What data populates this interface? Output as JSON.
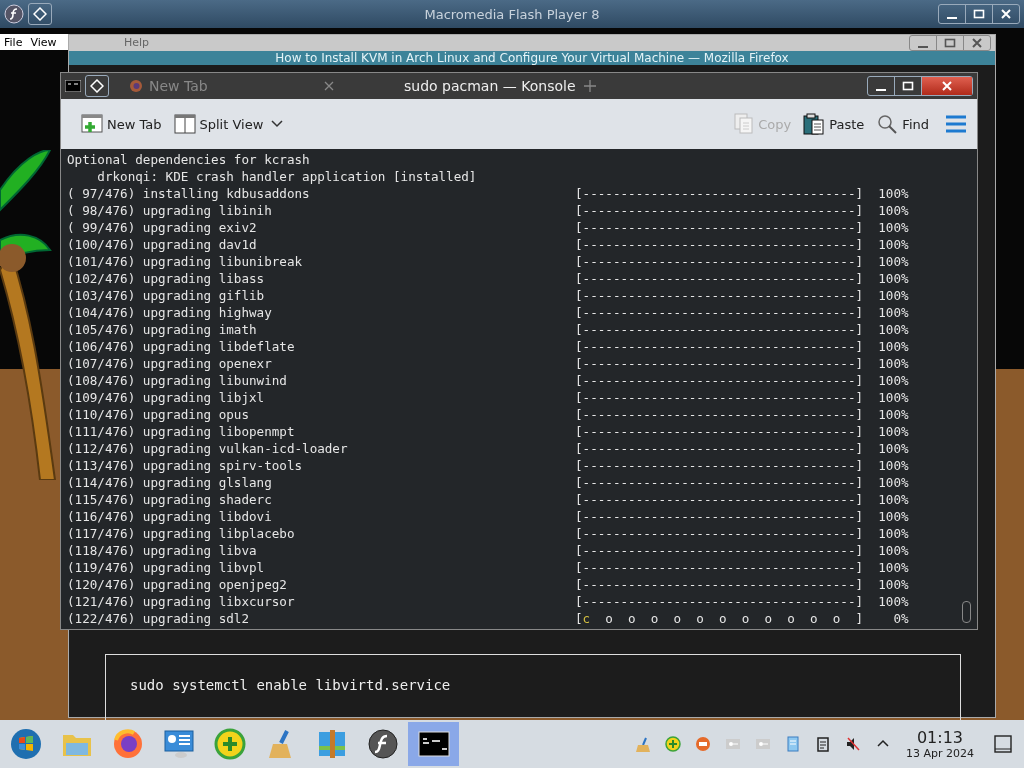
{
  "flash_window": {
    "title": "Macromedia Flash Player 8",
    "menu": [
      {
        "label": "File"
      },
      {
        "label": "View"
      },
      {
        "label": "Help"
      }
    ]
  },
  "browser_window": {
    "title": "How to Install KVM in Arch Linux and Configure Your Virtual Machine — Mozilla Firefox",
    "code": "sudo systemctl enable libvirtd.service"
  },
  "konsole": {
    "title": "sudo pacman — Konsole",
    "ghost_tab": "New Tab",
    "toolbar": [
      {
        "kind": "new-tab",
        "label": "New Tab",
        "disabled": false
      },
      {
        "kind": "split",
        "label": "Split View",
        "disabled": false
      },
      {
        "kind": "copy",
        "label": "Copy",
        "disabled": true
      },
      {
        "kind": "paste",
        "label": "Paste",
        "disabled": false
      },
      {
        "kind": "find",
        "label": "Find",
        "disabled": false
      }
    ],
    "lines": [
      {
        "kind": "text",
        "text": "Optional dependencies for kcrash"
      },
      {
        "kind": "text",
        "text": "    drkonqi: KDE crash handler application [installed]"
      },
      {
        "kind": "progress",
        "text": "( 97/476) installing kdbusaddons",
        "bar": "[------------------------------------]",
        "percent": "100%"
      },
      {
        "kind": "progress",
        "text": "( 98/476) upgrading libinih",
        "bar": "[------------------------------------]",
        "percent": "100%"
      },
      {
        "kind": "progress",
        "text": "( 99/476) upgrading exiv2",
        "bar": "[------------------------------------]",
        "percent": "100%"
      },
      {
        "kind": "progress",
        "text": "(100/476) upgrading dav1d",
        "bar": "[------------------------------------]",
        "percent": "100%"
      },
      {
        "kind": "progress",
        "text": "(101/476) upgrading libunibreak",
        "bar": "[------------------------------------]",
        "percent": "100%"
      },
      {
        "kind": "progress",
        "text": "(102/476) upgrading libass",
        "bar": "[------------------------------------]",
        "percent": "100%"
      },
      {
        "kind": "progress",
        "text": "(103/476) upgrading giflib",
        "bar": "[------------------------------------]",
        "percent": "100%"
      },
      {
        "kind": "progress",
        "text": "(104/476) upgrading highway",
        "bar": "[------------------------------------]",
        "percent": "100%"
      },
      {
        "kind": "progress",
        "text": "(105/476) upgrading imath",
        "bar": "[------------------------------------]",
        "percent": "100%"
      },
      {
        "kind": "progress",
        "text": "(106/476) upgrading libdeflate",
        "bar": "[------------------------------------]",
        "percent": "100%"
      },
      {
        "kind": "progress",
        "text": "(107/476) upgrading openexr",
        "bar": "[------------------------------------]",
        "percent": "100%"
      },
      {
        "kind": "progress",
        "text": "(108/476) upgrading libunwind",
        "bar": "[------------------------------------]",
        "percent": "100%"
      },
      {
        "kind": "progress",
        "text": "(109/476) upgrading libjxl",
        "bar": "[------------------------------------]",
        "percent": "100%"
      },
      {
        "kind": "progress",
        "text": "(110/476) upgrading opus",
        "bar": "[------------------------------------]",
        "percent": "100%"
      },
      {
        "kind": "progress",
        "text": "(111/476) upgrading libopenmpt",
        "bar": "[------------------------------------]",
        "percent": "100%"
      },
      {
        "kind": "progress",
        "text": "(112/476) upgrading vulkan-icd-loader",
        "bar": "[------------------------------------]",
        "percent": "100%"
      },
      {
        "kind": "progress",
        "text": "(113/476) upgrading spirv-tools",
        "bar": "[------------------------------------]",
        "percent": "100%"
      },
      {
        "kind": "progress",
        "text": "(114/476) upgrading glslang",
        "bar": "[------------------------------------]",
        "percent": "100%"
      },
      {
        "kind": "progress",
        "text": "(115/476) upgrading shaderc",
        "bar": "[------------------------------------]",
        "percent": "100%"
      },
      {
        "kind": "progress",
        "text": "(116/476) upgrading libdovi",
        "bar": "[------------------------------------]",
        "percent": "100%"
      },
      {
        "kind": "progress",
        "text": "(117/476) upgrading libplacebo",
        "bar": "[------------------------------------]",
        "percent": "100%"
      },
      {
        "kind": "progress",
        "text": "(118/476) upgrading libva",
        "bar": "[------------------------------------]",
        "percent": "100%"
      },
      {
        "kind": "progress",
        "text": "(119/476) upgrading libvpl",
        "bar": "[------------------------------------]",
        "percent": "100%"
      },
      {
        "kind": "progress",
        "text": "(120/476) upgrading openjpeg2",
        "bar": "[------------------------------------]",
        "percent": "100%"
      },
      {
        "kind": "progress",
        "text": "(121/476) upgrading libxcursor",
        "bar": "[------------------------------------]",
        "percent": "100%"
      },
      {
        "kind": "pacman",
        "text": "(122/476) upgrading sdl2",
        "bar_start": "[",
        "pacman": "c",
        "bar_rest": "  o  o  o  o  o  o  o  o  o  o  o  ]",
        "percent": "0%"
      }
    ]
  },
  "taskbar": {
    "apps": [
      {
        "kind": "start",
        "selected": false
      },
      {
        "kind": "folder",
        "selected": false
      },
      {
        "kind": "firefox",
        "selected": false
      },
      {
        "kind": "remote",
        "selected": false
      },
      {
        "kind": "plus",
        "selected": false
      },
      {
        "kind": "broom",
        "selected": false
      },
      {
        "kind": "archive",
        "selected": false
      },
      {
        "kind": "flash",
        "selected": false
      },
      {
        "kind": "terminal",
        "selected": true
      }
    ],
    "time": "01:13",
    "date": "13 Apr 2024"
  }
}
